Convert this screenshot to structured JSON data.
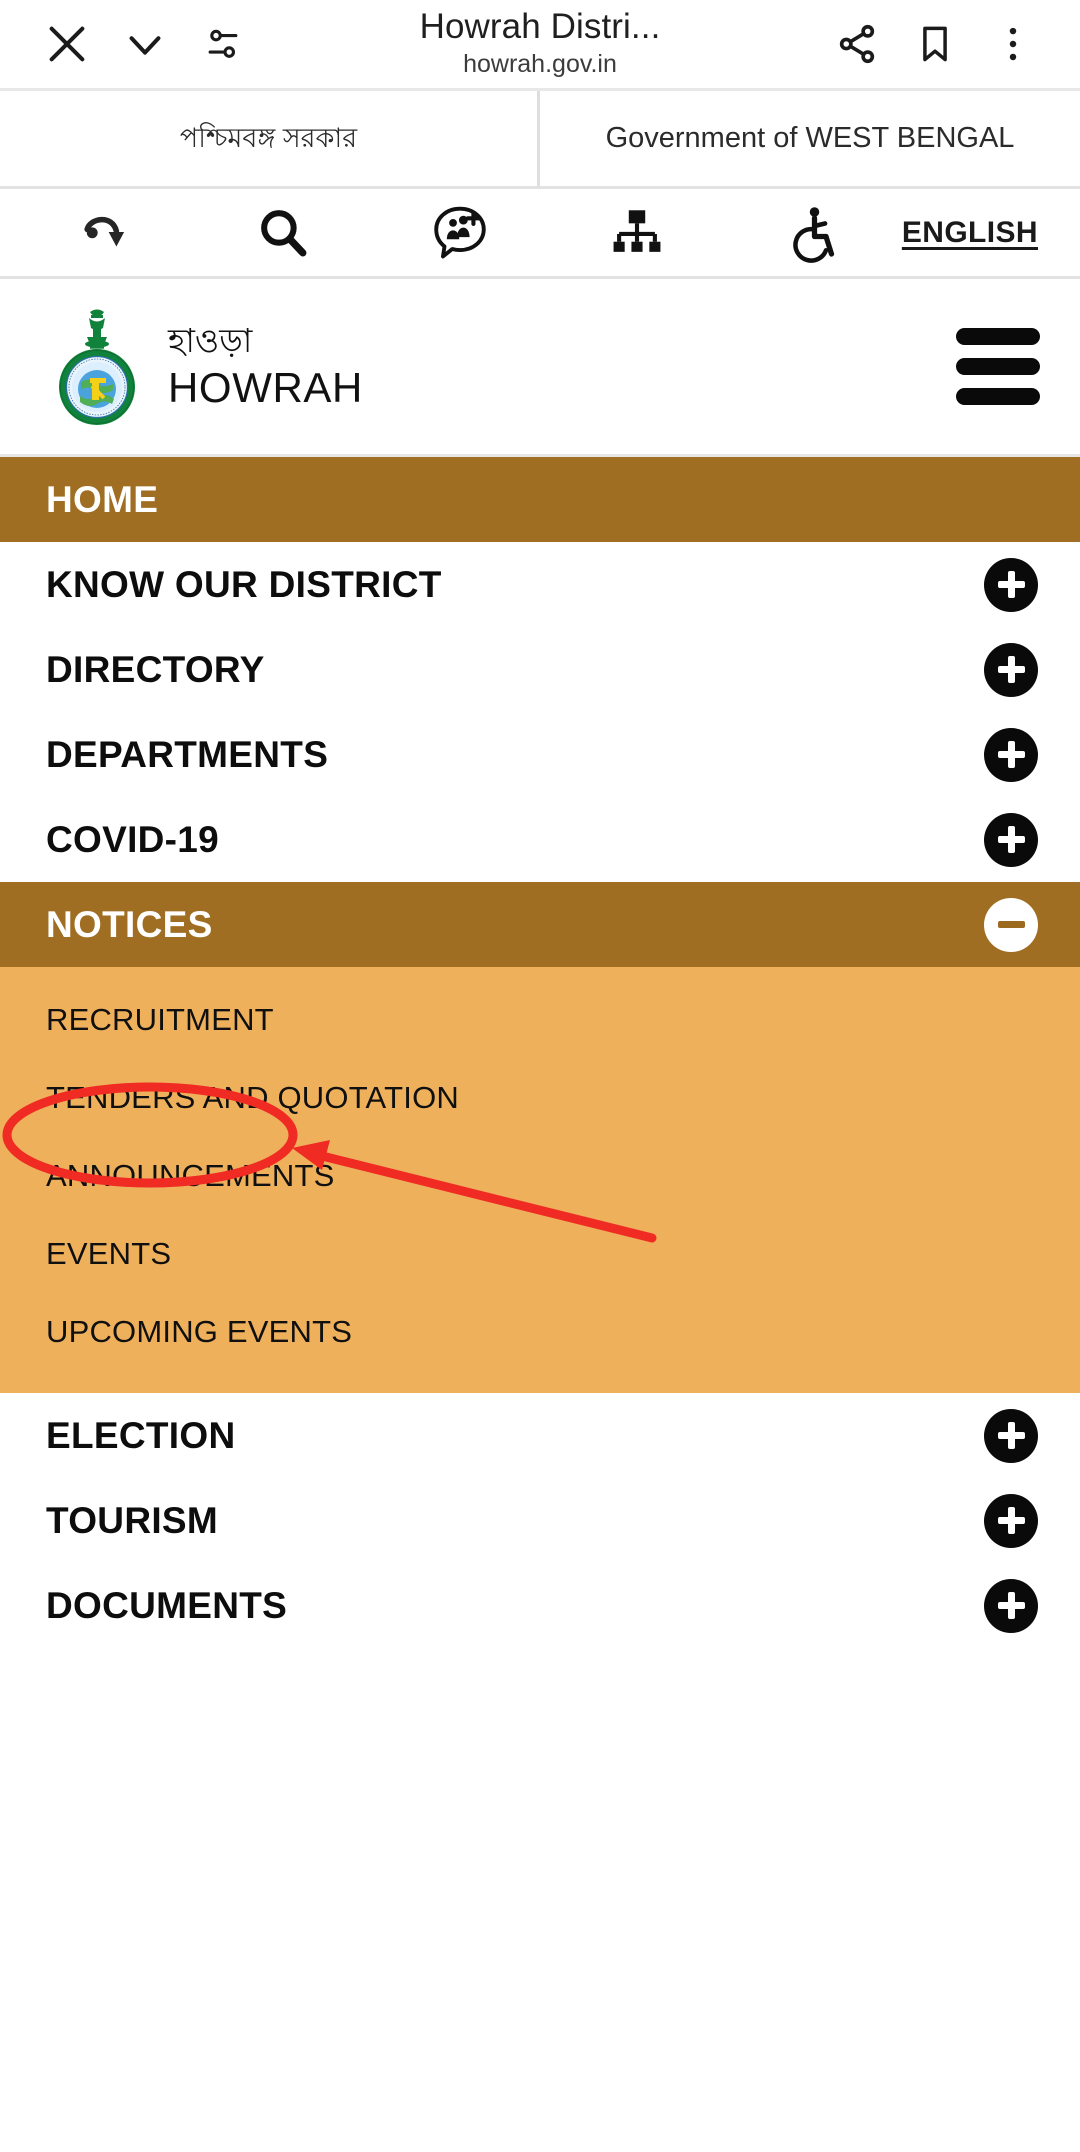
{
  "browser": {
    "close_label": "✕",
    "collapse_label": "⌄",
    "tune_label": "tune",
    "page_title": "Howrah Distri...",
    "page_url": "howrah.gov.in",
    "share_label": "share",
    "bookmark_label": "bookmark",
    "more_label": "more"
  },
  "gov_bar": {
    "bengali": "পশ্চিমবঙ্গ সরকার",
    "english": "Government of WEST BENGAL"
  },
  "accessibility": {
    "items": [
      {
        "name": "skip-to-content-icon",
        "label": "Skip to main content"
      },
      {
        "name": "search-icon",
        "label": "Search"
      },
      {
        "name": "social-media-icon",
        "label": "Social media"
      },
      {
        "name": "sitemap-icon",
        "label": "Sitemap"
      },
      {
        "name": "accessibility-icon",
        "label": "Accessibility"
      }
    ],
    "language": "ENGLISH"
  },
  "brand": {
    "name_bn": "হাওড়া",
    "name_en": "HOWRAH",
    "emblem_ring_text": "GOVT OF WEST BENGAL",
    "menu_label": "Menu"
  },
  "nav": {
    "items": [
      {
        "label": "HOME",
        "active": true,
        "toggle": "none"
      },
      {
        "label": "KNOW OUR DISTRICT",
        "active": false,
        "toggle": "plus"
      },
      {
        "label": "DIRECTORY",
        "active": false,
        "toggle": "plus"
      },
      {
        "label": "DEPARTMENTS",
        "active": false,
        "toggle": "plus"
      },
      {
        "label": "COVID-19",
        "active": false,
        "toggle": "plus"
      },
      {
        "label": "NOTICES",
        "active": true,
        "toggle": "minus"
      }
    ],
    "notices_submenu": [
      {
        "label": "RECRUITMENT"
      },
      {
        "label": "TENDERS AND QUOTATION"
      },
      {
        "label": "ANNOUNCEMENTS"
      },
      {
        "label": "EVENTS"
      },
      {
        "label": "UPCOMING EVENTS"
      }
    ],
    "items_after": [
      {
        "label": "ELECTION",
        "active": false,
        "toggle": "plus"
      },
      {
        "label": "TOURISM",
        "active": false,
        "toggle": "plus"
      },
      {
        "label": "DOCUMENTS",
        "active": false,
        "toggle": "plus"
      }
    ]
  },
  "colors": {
    "accent_brown": "#a06e22",
    "submenu_orange": "#efb05c",
    "annotation_red": "#ef2b23",
    "emblem_green": "#11823b"
  },
  "annotation": {
    "highlight_target": "ANNOUNCEMENTS",
    "shape": "ellipse-with-arrow"
  }
}
